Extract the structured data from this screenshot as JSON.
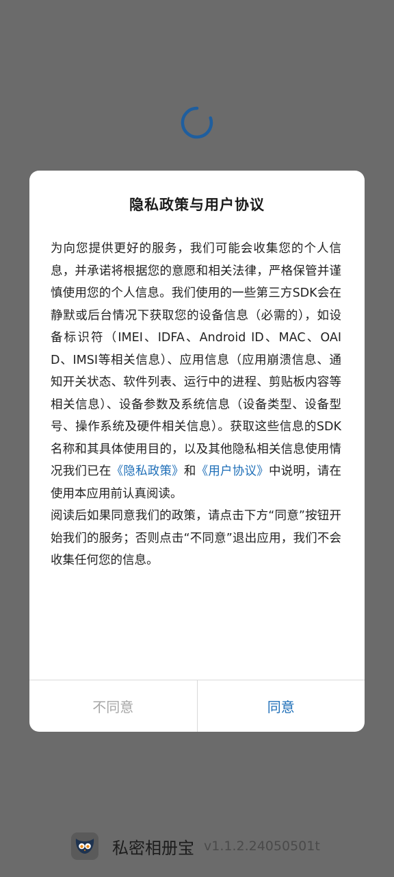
{
  "dialog": {
    "title": "隐私政策与用户协议",
    "body_part1": "为向您提供更好的服务，我们可能会收集您的个人信息，并承诺将根据您的意愿和相关法律，严格保管并谨慎使用您的个人信息。我们使用的一些第三方SDK会在静默或后台情况下获取您的设备信息（必需的），如设备标识符（IMEI、IDFA、Android ID、MAC、OAID、IMSI等相关信息）、应用信息（应用崩溃信息、通知开关状态、软件列表、运行中的进程、剪贴板内容等相关信息）、设备参数及系统信息（设备类型、设备型号、操作系统及硬件相关信息）。获取这些信息的SDK名称和其具体使用目的，以及其他隐私相关信息使用情况我们已在",
    "privacy_link": "《隐私政策》",
    "and_text": "和",
    "user_agreement_link": "《用户协议》",
    "body_part2": "中说明，请在使用本应用前认真阅读。",
    "body_paragraph2": "阅读后如果同意我们的政策，请点击下方“同意”按钮开始我们的服务；否则点击“不同意”退出应用，我们不会收集任何您的信息。",
    "disagree_label": "不同意",
    "agree_label": "同意"
  },
  "footer": {
    "app_name": "私密相册宝",
    "version": "v1.1.2.24050501t"
  },
  "colors": {
    "overlay": "#6b6b6b",
    "accent": "#1f6fb8",
    "disabled": "#a6a6a6",
    "spinner": "#1f5e9e"
  },
  "icons": {
    "spinner": "loading-spinner-icon",
    "app": "owl-app-icon"
  }
}
